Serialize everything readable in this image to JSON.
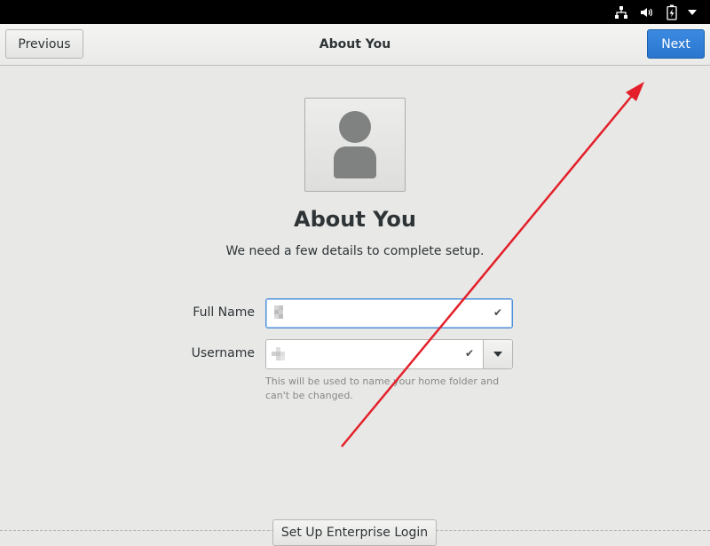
{
  "header": {
    "title": "About You",
    "previous_label": "Previous",
    "next_label": "Next"
  },
  "main": {
    "title": "About You",
    "subtitle": "We need a few details to complete setup.",
    "full_name": {
      "label": "Full Name",
      "value": ""
    },
    "username": {
      "label": "Username",
      "value": "",
      "hint": "This will be used to name your home folder and can't be changed."
    },
    "enterprise_login_label": "Set Up Enterprise Login"
  },
  "system_tray": {
    "icons": [
      "network-icon",
      "volume-icon",
      "battery-icon",
      "menu-arrow-icon"
    ]
  },
  "colors": {
    "next_button": "#2a76cf",
    "focus_border": "#4a90d9",
    "annotation_arrow": "#e3202a"
  }
}
